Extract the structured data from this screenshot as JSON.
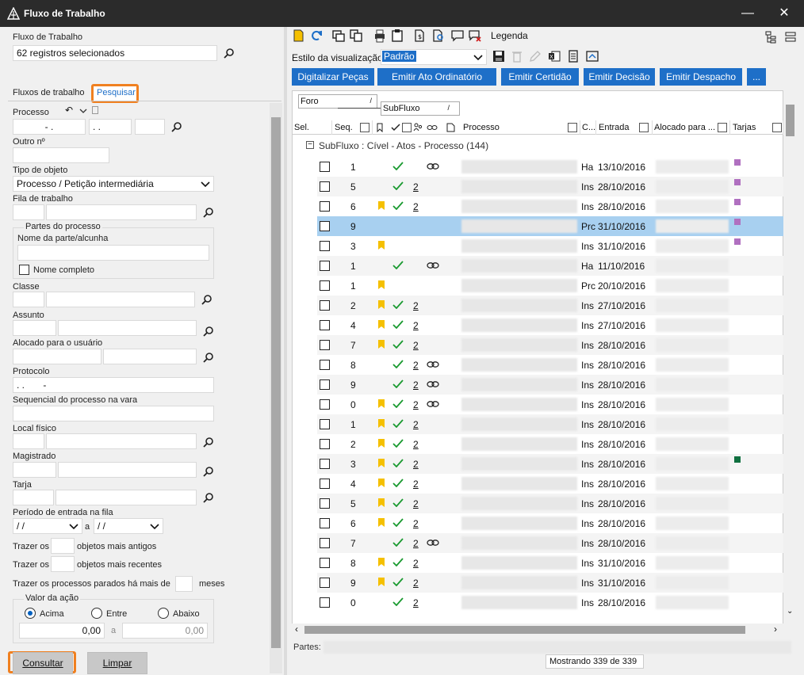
{
  "window": {
    "title": "Fluxo de Trabalho",
    "minimize": "—",
    "close": "✕"
  },
  "left": {
    "fluxo_label": "Fluxo de Trabalho",
    "fluxo_value": "62 registros selecionados",
    "tabs": [
      "Fluxos de trabalho",
      "Pesquisar"
    ],
    "processo_label": "Processo",
    "processo_parts": [
      "- .",
      ". .",
      ""
    ],
    "outro_label": "Outro nº",
    "tipo_label": "Tipo de objeto",
    "tipo_value": "Processo / Petição intermediária",
    "fila_label": "Fila de trabalho",
    "partes_group": "Partes do processo",
    "nome_parte_label": "Nome da parte/alcunha",
    "nome_completo": "Nome completo",
    "classe_label": "Classe",
    "assunto_label": "Assunto",
    "alocado_label": "Alocado para o usuário",
    "protocolo_label": "Protocolo",
    "protocolo_value": ". .       -",
    "sequencial_label": "Sequencial do processo na vara",
    "local_label": "Local físico",
    "magistrado_label": "Magistrado",
    "tarja_label": "Tarja",
    "periodo_label": "Período de entrada na fila",
    "periodo_from": "/ /",
    "periodo_a": "a",
    "periodo_to": "/ /",
    "trazer1_a": "Trazer os",
    "trazer1_b": "objetos mais antigos",
    "trazer2_a": "Trazer os",
    "trazer2_b": "objetos mais recentes",
    "trazer3_a": "Trazer os processos parados há mais de",
    "trazer3_b": "meses",
    "valor_group": "Valor da ação",
    "radios": [
      "Acima",
      "Entre",
      "Abaixo"
    ],
    "valor_from": "0,00",
    "valor_a": "a",
    "valor_to": "0,00",
    "consultar": "Consultar",
    "limpar": "Limpar"
  },
  "right": {
    "legenda": "Legenda",
    "estilo_label": "Estilo da visualização",
    "estilo_value": "Padrão",
    "actions": [
      "Digitalizar Peças",
      "Emitir Ato Ordinatório",
      "Emitir Certidão",
      "Emitir Decisão",
      "Emitir Despacho",
      "..."
    ],
    "group_chips": [
      "Foro",
      "SubFluxo"
    ],
    "columns": [
      "Sel.",
      "Seq.",
      "Processo",
      "C...",
      "Entrada",
      "Alocado para ...",
      "Tarjas"
    ],
    "group_row": "SubFluxo : Cível - Atos - Processo  (144)",
    "rows": [
      {
        "seq": "1",
        "flag": false,
        "tick": true,
        "cnt": "",
        "lnk": true,
        "c": "Ha",
        "dt": "13/10/2016",
        "tj": "#b070c0"
      },
      {
        "seq": "5",
        "flag": false,
        "tick": true,
        "cnt": "2",
        "lnk": false,
        "c": "Ins",
        "dt": "28/10/2016",
        "tj": "#b070c0"
      },
      {
        "seq": "6",
        "flag": true,
        "tick": true,
        "cnt": "2",
        "lnk": false,
        "c": "Ins",
        "dt": "28/10/2016",
        "tj": "#b070c0"
      },
      {
        "seq": "9",
        "flag": false,
        "tick": false,
        "cnt": "",
        "lnk": false,
        "c": "Prc",
        "dt": "31/10/2016",
        "tj": "#b070c0"
      },
      {
        "seq": "3",
        "flag": true,
        "tick": false,
        "cnt": "",
        "lnk": false,
        "c": "Ins",
        "dt": "31/10/2016",
        "tj": "#b070c0"
      },
      {
        "seq": "1",
        "flag": false,
        "tick": true,
        "cnt": "",
        "lnk": true,
        "c": "Ha",
        "dt": "11/10/2016",
        "tj": ""
      },
      {
        "seq": "1",
        "flag": true,
        "tick": false,
        "cnt": "",
        "lnk": false,
        "c": "Prc",
        "dt": "20/10/2016",
        "tj": ""
      },
      {
        "seq": "2",
        "flag": true,
        "tick": true,
        "cnt": "2",
        "lnk": false,
        "c": "Ins",
        "dt": "27/10/2016",
        "tj": ""
      },
      {
        "seq": "4",
        "flag": true,
        "tick": true,
        "cnt": "2",
        "lnk": false,
        "c": "Ins",
        "dt": "27/10/2016",
        "tj": ""
      },
      {
        "seq": "7",
        "flag": true,
        "tick": true,
        "cnt": "2",
        "lnk": false,
        "c": "Ins",
        "dt": "28/10/2016",
        "tj": ""
      },
      {
        "seq": "8",
        "flag": false,
        "tick": true,
        "cnt": "2",
        "lnk": true,
        "c": "Ins",
        "dt": "28/10/2016",
        "tj": ""
      },
      {
        "seq": "9",
        "flag": false,
        "tick": true,
        "cnt": "2",
        "lnk": true,
        "c": "Ins",
        "dt": "28/10/2016",
        "tj": ""
      },
      {
        "seq": "0",
        "flag": true,
        "tick": true,
        "cnt": "2",
        "lnk": true,
        "c": "Ins",
        "dt": "28/10/2016",
        "tj": ""
      },
      {
        "seq": "1",
        "flag": true,
        "tick": true,
        "cnt": "2",
        "lnk": false,
        "c": "Ins",
        "dt": "28/10/2016",
        "tj": ""
      },
      {
        "seq": "2",
        "flag": true,
        "tick": true,
        "cnt": "2",
        "lnk": false,
        "c": "Ins",
        "dt": "28/10/2016",
        "tj": ""
      },
      {
        "seq": "3",
        "flag": true,
        "tick": true,
        "cnt": "2",
        "lnk": false,
        "c": "Ins",
        "dt": "28/10/2016",
        "tj": "#107040"
      },
      {
        "seq": "4",
        "flag": true,
        "tick": true,
        "cnt": "2",
        "lnk": false,
        "c": "Ins",
        "dt": "28/10/2016",
        "tj": ""
      },
      {
        "seq": "5",
        "flag": true,
        "tick": true,
        "cnt": "2",
        "lnk": false,
        "c": "Ins",
        "dt": "28/10/2016",
        "tj": ""
      },
      {
        "seq": "6",
        "flag": true,
        "tick": true,
        "cnt": "2",
        "lnk": false,
        "c": "Ins",
        "dt": "28/10/2016",
        "tj": ""
      },
      {
        "seq": "7",
        "flag": false,
        "tick": true,
        "cnt": "2",
        "lnk": true,
        "c": "Ins",
        "dt": "28/10/2016",
        "tj": ""
      },
      {
        "seq": "8",
        "flag": true,
        "tick": true,
        "cnt": "2",
        "lnk": false,
        "c": "Ins",
        "dt": "31/10/2016",
        "tj": ""
      },
      {
        "seq": "9",
        "flag": true,
        "tick": true,
        "cnt": "2",
        "lnk": false,
        "c": "Ins",
        "dt": "31/10/2016",
        "tj": ""
      },
      {
        "seq": "0",
        "flag": false,
        "tick": true,
        "cnt": "2",
        "lnk": false,
        "c": "Ins",
        "dt": "28/10/2016",
        "tj": ""
      }
    ],
    "partes_label": "Partes:",
    "mostrando": "Mostrando 339 de 339"
  },
  "colors": {
    "accent": "#1e6fc8",
    "orange": "#f08020",
    "flag": "#f5c000",
    "tick": "#1a9a30",
    "highlight": "#a8d0f0"
  }
}
